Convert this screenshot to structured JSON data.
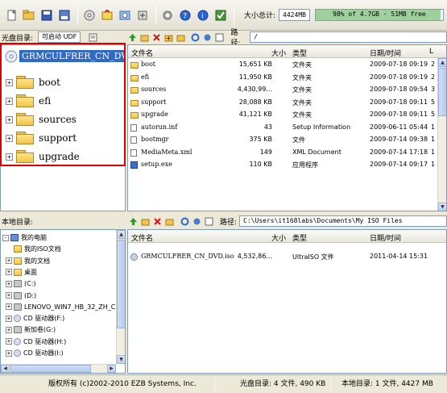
{
  "toolbar": {
    "buttons": [
      "new-icon",
      "open-icon",
      "save-icon",
      "save-as-icon",
      "extract-icon",
      "burn-icon",
      "mount-icon",
      "compress-icon",
      "options-icon",
      "help-icon",
      "about-icon",
      "register-icon"
    ],
    "size_label": "大小总计:",
    "size_value": "4424MB",
    "progress_text": "98% of 4.7GB - 51MB free",
    "progress_percent": 98
  },
  "iso_pane": {
    "header_label": "光盘目录:",
    "boot_combo": "可启动 UDF",
    "path_label": "路径:",
    "path_value": "/",
    "root": "GRMCULFRER_CN_DVD",
    "folders": [
      "boot",
      "efi",
      "sources",
      "support",
      "upgrade"
    ]
  },
  "iso_list": {
    "columns": [
      "文件名",
      "大小",
      "类型",
      "日期/时间",
      "L"
    ],
    "rows": [
      {
        "name": "boot",
        "size": "15,651 KB",
        "type": "文件夹",
        "date": "2009-07-18 09:19",
        "l": "2",
        "icon": "folder"
      },
      {
        "name": "efi",
        "size": "11,950 KB",
        "type": "文件夹",
        "date": "2009-07-18 09:19",
        "l": "2",
        "icon": "folder"
      },
      {
        "name": "sources",
        "size": "4,430,99...",
        "type": "文件夹",
        "date": "2009-07-18 09:54",
        "l": "3",
        "icon": "folder"
      },
      {
        "name": "support",
        "size": "28,088 KB",
        "type": "文件夹",
        "date": "2009-07-18 09:11",
        "l": "5",
        "icon": "folder"
      },
      {
        "name": "upgrade",
        "size": "41,121 KB",
        "type": "文件夹",
        "date": "2009-07-18 09:11",
        "l": "5",
        "icon": "folder"
      },
      {
        "name": "autorun.inf",
        "size": "43",
        "type": "Setup Information",
        "date": "2009-06-11 05:44",
        "l": "1",
        "icon": "doc"
      },
      {
        "name": "bootmgr",
        "size": "375 KB",
        "type": "文件",
        "date": "2009-07-14 09:38",
        "l": "1",
        "icon": "doc"
      },
      {
        "name": "MediaMeta.xml",
        "size": "149",
        "type": "XML Document",
        "date": "2009-07-14 17:18",
        "l": "1",
        "icon": "doc"
      },
      {
        "name": "setup.exe",
        "size": "110 KB",
        "type": "应用程序",
        "date": "2009-07-14 09:17",
        "l": "1",
        "icon": "exe"
      }
    ]
  },
  "local_pane": {
    "header_label": "本地目录:",
    "path_label": "路径:",
    "path_value": "C:\\Users\\it168labs\\Documents\\My ISO Files",
    "tree": [
      {
        "label": "我的电脑",
        "icon": "pc",
        "indent": 0,
        "exp": "-"
      },
      {
        "label": "我的ISO文档",
        "icon": "folder",
        "indent": 1,
        "exp": ""
      },
      {
        "label": "我的文档",
        "icon": "folder",
        "indent": 1,
        "exp": "+"
      },
      {
        "label": "桌面",
        "icon": "folder",
        "indent": 1,
        "exp": "+"
      },
      {
        "label": "(C:)",
        "icon": "drive",
        "indent": 1,
        "exp": "+"
      },
      {
        "label": "(D:)",
        "icon": "drive",
        "indent": 1,
        "exp": "+"
      },
      {
        "label": "LENOVO_WIN7_HB_32_ZH_CN_RI",
        "icon": "drive",
        "indent": 1,
        "exp": "+"
      },
      {
        "label": "CD 驱动器(F:)",
        "icon": "cd",
        "indent": 1,
        "exp": "+"
      },
      {
        "label": "新加卷(G:)",
        "icon": "drive",
        "indent": 1,
        "exp": "+"
      },
      {
        "label": "CD 驱动器(H:)",
        "icon": "cd",
        "indent": 1,
        "exp": "+"
      },
      {
        "label": "CD 驱动器(I:)",
        "icon": "cd",
        "indent": 1,
        "exp": "+"
      }
    ]
  },
  "local_list": {
    "columns": [
      "文件名",
      "大小",
      "类型",
      "日期/时间"
    ],
    "rows": [
      {
        "name": "GRMCULFRER_CN_DVD.iso",
        "size": "4,532,86...",
        "type": "UltraISO 文件",
        "date": "2011-04-14 15:31"
      }
    ]
  },
  "status": {
    "copyright": "版权所有 (c)2002-2010 EZB Systems, Inc.",
    "iso_info": "光盘目录: 4 文件, 490 KB",
    "local_info": "本地目录: 1 文件, 4427 MB"
  },
  "colors": {
    "selection": "#316ac5",
    "highlight_frame": "#e00000",
    "progress_fill": "#9ed09e"
  }
}
